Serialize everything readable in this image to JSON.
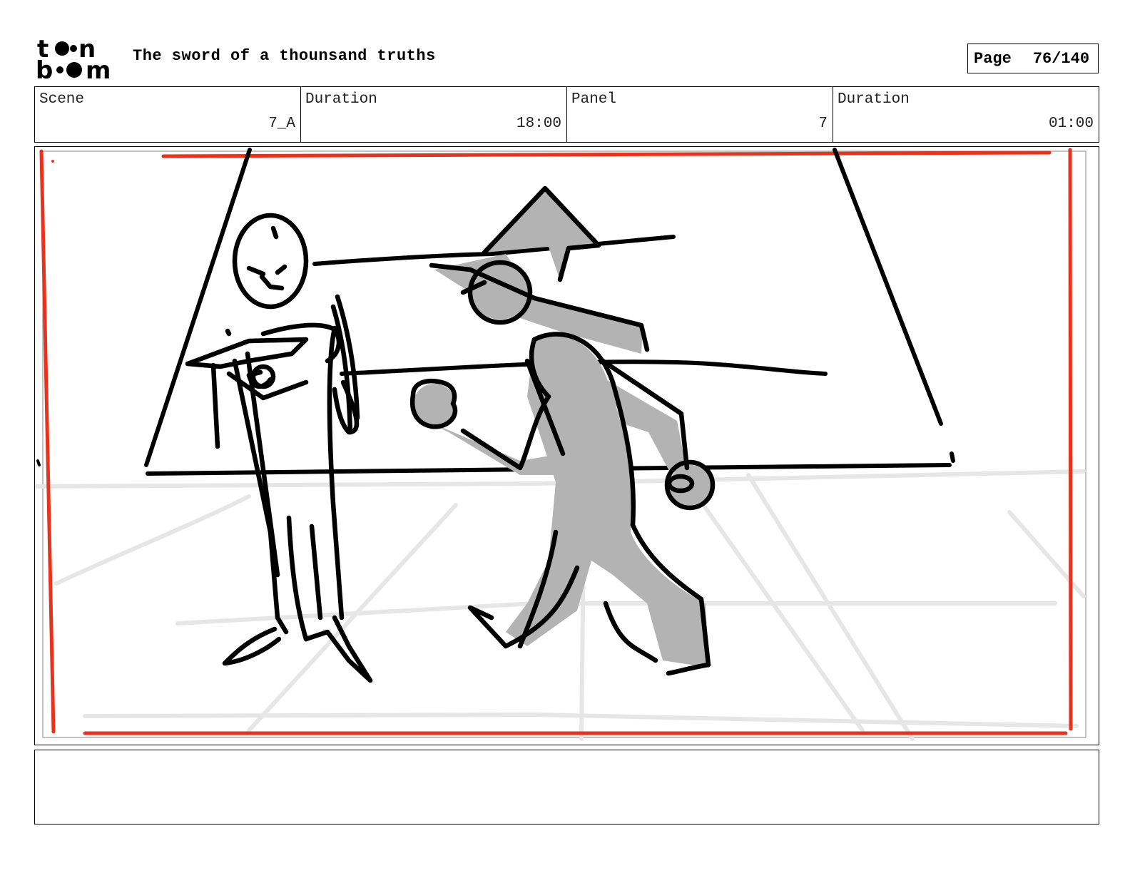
{
  "header": {
    "logo_text": "toon boom",
    "title": "The sword of a thounsand truths",
    "page_label": "Page",
    "page_value": "76/140"
  },
  "info": {
    "scene_label": "Scene",
    "scene_value": "7_A",
    "scene_duration_label": "Duration",
    "scene_duration_value": "18:00",
    "panel_label": "Panel",
    "panel_value": "7",
    "panel_duration_label": "Duration",
    "panel_duration_value": "01:00"
  },
  "colors": {
    "safe_frame": "#e8321c",
    "character_fill": "#b3b3b3",
    "floor_lines": "#e6e6e6"
  },
  "notes": {
    "text": ""
  }
}
